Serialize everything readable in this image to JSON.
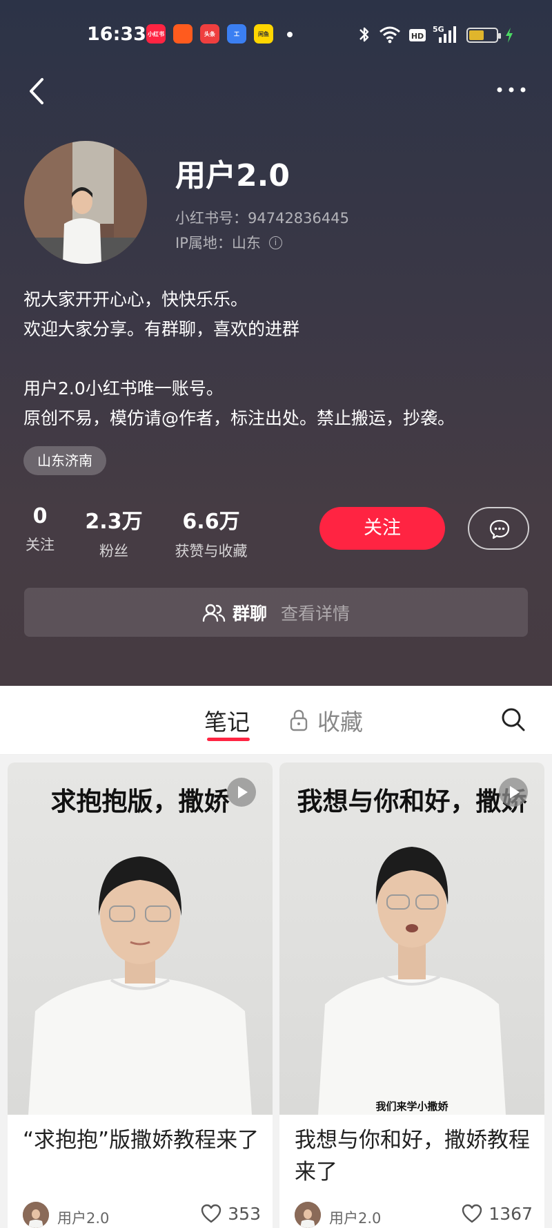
{
  "status_bar": {
    "time": "16:33",
    "apps": [
      {
        "label": "小红书",
        "color": "#ff2442"
      },
      {
        "label": "",
        "color": "#ff5b1e"
      },
      {
        "label": "头条",
        "color": "#ef3f3f"
      },
      {
        "label": "工",
        "color": "#3b7ff2"
      },
      {
        "label": "闲鱼",
        "color": "#ffd600"
      }
    ],
    "network": "5G",
    "hd": "HD",
    "battery_level": 0.55
  },
  "profile": {
    "name": "用户2.0",
    "id_text": "小红书号：94742836445",
    "ip_text": "IP属地：山东",
    "bio": "祝大家开开心心，快快乐乐。\n欢迎大家分享。有群聊，喜欢的进群\n\n用户2.0小红书唯一账号。\n原创不易，模仿请@作者，标注出处。禁止搬运，抄袭。",
    "tag": "山东济南",
    "stats": [
      {
        "num": "0",
        "label": "关注"
      },
      {
        "num": "2.3万",
        "label": "粉丝"
      },
      {
        "num": "6.6万",
        "label": "获赞与收藏"
      }
    ],
    "follow_label": "关注",
    "group_label": "群聊",
    "group_detail": "查看详情"
  },
  "tabs": {
    "notes": "笔记",
    "favorites": "收藏"
  },
  "cards": [
    {
      "cover_text": "求抱抱版，撒娇",
      "subtitle": "",
      "title": "“求抱抱”版撒娇教程来了",
      "author": "用户2.0",
      "likes": "353"
    },
    {
      "cover_text": "我想与你和好，撒娇",
      "subtitle": "我们来学小撒娇",
      "title": "我想与你和好，撒娇教程来了",
      "author": "用户2.0",
      "likes": "1367"
    }
  ],
  "colors": {
    "accent": "#ff2442"
  }
}
